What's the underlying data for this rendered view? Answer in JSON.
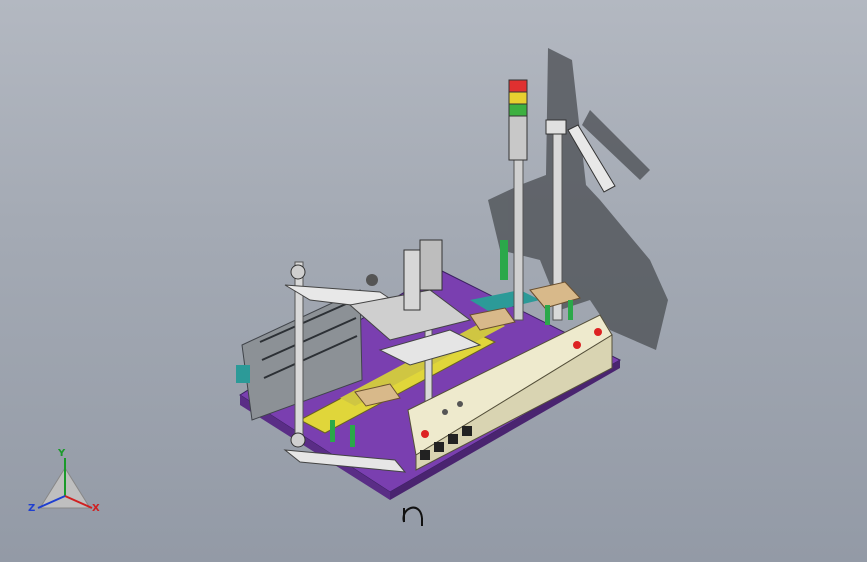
{
  "viewport": {
    "background_top": "#b3b8c1",
    "background_bottom": "#939aa6"
  },
  "model": {
    "base_plate_color": "#8a47c2",
    "frame_color": "#d4d4d4",
    "panel_color": "#eeeacd",
    "accent_yellow": "#e0d63a",
    "accent_green": "#2ba84a",
    "accent_teal": "#2c9a98",
    "tower_light": [
      "red",
      "yellow",
      "green"
    ]
  },
  "triad": {
    "x_label": "X",
    "y_label": "Y",
    "z_label": "Z",
    "x_color": "#d02020",
    "y_color": "#1a9a2a",
    "z_color": "#1f3fd0"
  },
  "rotate_cursor": "rotate-cursor-icon"
}
